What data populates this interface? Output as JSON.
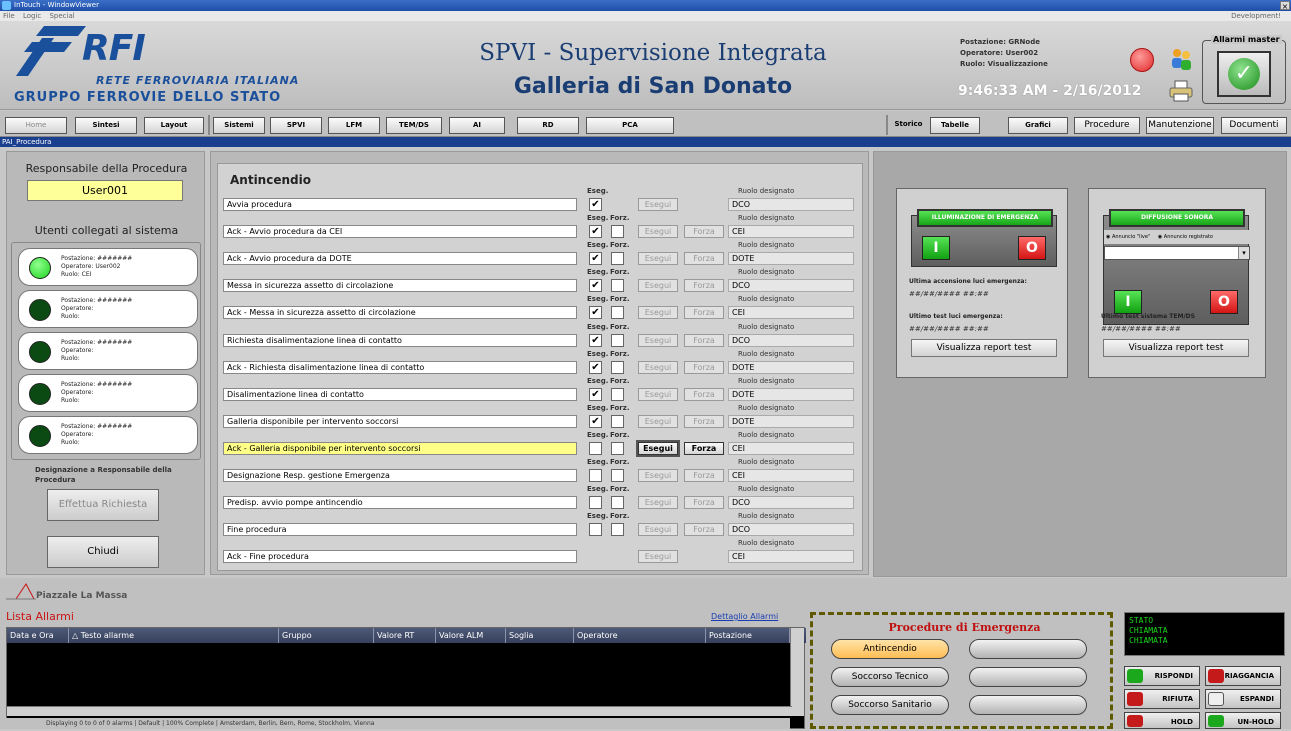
{
  "window": {
    "title": "InTouch - WindowViewer",
    "menu": [
      "File",
      "Logic",
      "Special"
    ],
    "dev_label": "Development!"
  },
  "header": {
    "logo_rfi": "RFI",
    "logo_sub": "RETE FERROVIARIA ITALIANA",
    "logo_group": "GRUPPO FERROVIE DELLO STATO",
    "title1": "SPVI - Supervisione Integrata",
    "title2": "Galleria di San Donato",
    "postazione": "Postazione: GRNode",
    "operatore": "Operatore: User002",
    "ruolo": "Ruolo: Visualizzazione",
    "clock": "9:46:33 AM - 2/16/2012",
    "alarm_master": "Allarmi master"
  },
  "nav": {
    "home": "Home",
    "sintesi": "Sintesi",
    "layout": "Layout",
    "sistemi": "Sistemi",
    "spvi": "SPVI",
    "lfm": "LFM",
    "temds": "TEM/DS",
    "ai": "AI",
    "rd": "RD",
    "pca": "PCA",
    "storico": "Storico",
    "tabelle": "Tabelle",
    "grafici": "Grafici",
    "procedure": "Procedure",
    "manutenzione": "Manutenzione",
    "documenti": "Documenti"
  },
  "breadcrumb": "PAI_Procedura",
  "left": {
    "resp_title": "Responsabile della Procedura",
    "resp_value": "User001",
    "users_title": "Utenti collegati al sistema",
    "users": [
      {
        "postazione": "Postazione: #######",
        "operatore": "Operatore: User002",
        "ruolo": "Ruolo: CEI"
      },
      {
        "postazione": "Postazione: #######",
        "operatore": "Operatore:",
        "ruolo": "Ruolo:"
      },
      {
        "postazione": "Postazione: #######",
        "operatore": "Operatore:",
        "ruolo": "Ruolo:"
      },
      {
        "postazione": "Postazione: #######",
        "operatore": "Operatore:",
        "ruolo": "Ruolo:"
      },
      {
        "postazione": "Postazione: #######",
        "operatore": "Operatore:",
        "ruolo": "Ruolo:"
      }
    ],
    "designation": "Designazione a Responsabile della Procedura",
    "request_btn": "Effettua Richiesta",
    "close_btn": "Chiudi"
  },
  "proc": {
    "title": "Antincendio",
    "eseg_hdr": "Eseg.",
    "forz_hdr": "Forz.",
    "ruolo_hdr": "Ruolo designato",
    "esegui": "Esegui",
    "forza": "Forza",
    "rows": [
      {
        "name": "Avvia procedura",
        "role": "DCO"
      },
      {
        "name": "Ack - Avvio procedura da CEI",
        "role": "CEI"
      },
      {
        "name": "Ack - Avvio procedura da DOTE",
        "role": "DOTE"
      },
      {
        "name": "Messa in sicurezza assetto di circolazione",
        "role": "DCO"
      },
      {
        "name": "Ack - Messa in sicurezza assetto di circolazione",
        "role": "CEI"
      },
      {
        "name": "Richiesta disalimentazione linea di contatto",
        "role": "DCO"
      },
      {
        "name": "Ack - Richiesta disalimentazione linea di contatto",
        "role": "DOTE"
      },
      {
        "name": "Disalimentazione linea di contatto",
        "role": "DOTE"
      },
      {
        "name": "Galleria disponibile per intervento soccorsi",
        "role": "DOTE"
      },
      {
        "name": "Ack - Galleria disponibile per intervento soccorsi",
        "role": "CEI"
      },
      {
        "name": "Designazione Resp. gestione Emergenza",
        "role": "CEI"
      },
      {
        "name": "Predisp. avvio pompe antincendio",
        "role": "DCO"
      },
      {
        "name": "Fine procedura",
        "role": "DCO"
      },
      {
        "name": "Ack - Fine procedura",
        "role": "CEI"
      }
    ]
  },
  "right": {
    "illum": {
      "title": "ILLUMINAZIONE DI EMERGENZA",
      "last_on": "Ultima accensione luci emergenza:",
      "last_on_val": "##/##/#### ##:##",
      "last_test": "Ultimo test luci emergenza:",
      "last_test_val": "##/##/#### ##:##",
      "report": "Visualizza report test"
    },
    "sound": {
      "title": "DIFFUSIONE SONORA",
      "opt_live": "Annuncio \"live\"",
      "opt_rec": "Annuncio registrato",
      "last_test": "Ultimo test sistema TEM/DS",
      "last_test_val": "##/##/#### ##:##",
      "report": "Visualizza report test"
    },
    "btn_on": "I",
    "btn_off": "O"
  },
  "bottom": {
    "piazzale": "Piazzale La Massa",
    "lista": "Lista Allarmi",
    "dettaglio": "Dettaglio Allarmi",
    "columns": [
      "Data e Ora",
      "Testo allarme",
      "Gruppo",
      "Valore RT",
      "Valore ALM",
      "Soglia",
      "Operatore",
      "Postazione"
    ],
    "status": "Displaying 0 to 0 of 0 alarms | Default | 100% Complete | Amsterdam, Berlin, Bern, Rome, Stockholm, Vienna",
    "emergency_title": "Procedure di Emergenza",
    "emergency": [
      "Antincendio",
      "Soccorso Tecnico",
      "Soccorso Sanitario"
    ],
    "stato": [
      "STATO",
      "CHIAMATA",
      "CHIAMATA"
    ],
    "phone": [
      "RISPONDI",
      "RIAGGANCIA",
      "RIFIUTA",
      "ESPANDI",
      "HOLD",
      "UN-HOLD"
    ]
  }
}
